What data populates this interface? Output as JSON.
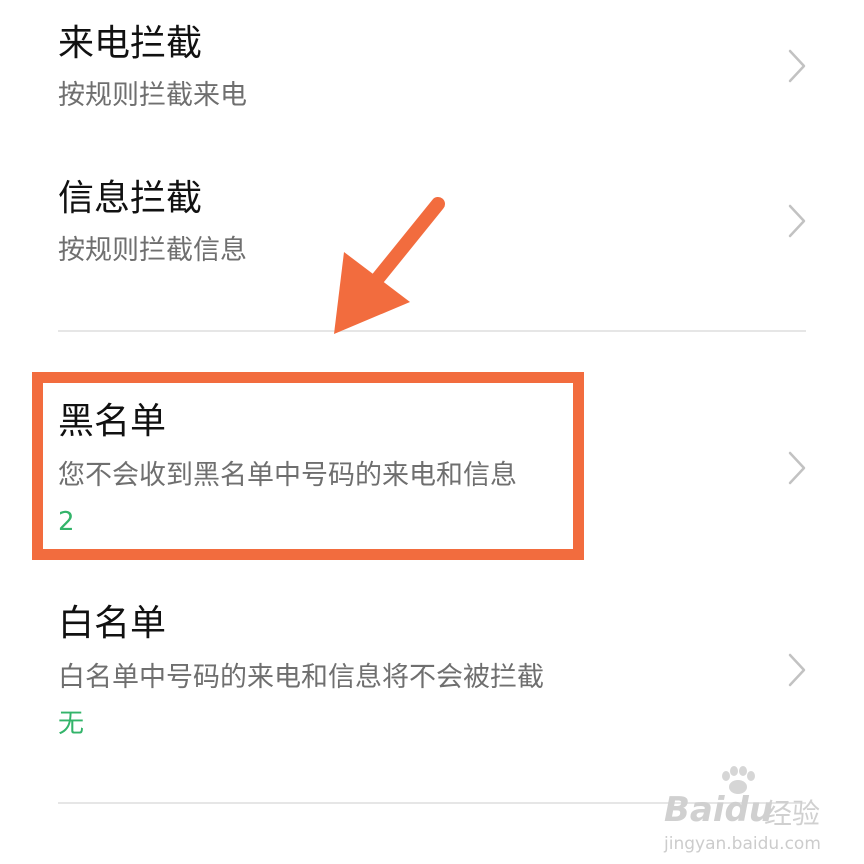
{
  "settings": {
    "items": [
      {
        "title": "来电拦截",
        "subtitle": "按规则拦截来电"
      },
      {
        "title": "信息拦截",
        "subtitle": "按规则拦截信息"
      },
      {
        "title": "黑名单",
        "subtitle": "您不会收到黑名单中号码的来电和信息",
        "value": "2"
      },
      {
        "title": "白名单",
        "subtitle": "白名单中号码的来电和信息将不会被拦截",
        "value": "无"
      }
    ]
  },
  "annotation": {
    "highlight_color": "#f26c3e",
    "arrow_color": "#f26c3e"
  },
  "watermark": {
    "brand": "Bai",
    "brand_suffix": "du",
    "product": "经验",
    "url": "jingyan.baidu.com"
  },
  "colors": {
    "value_green": "#33b46a",
    "title": "#111111",
    "subtitle": "#6f6f6f"
  },
  "icons": [
    "chevron-right-icon"
  ]
}
